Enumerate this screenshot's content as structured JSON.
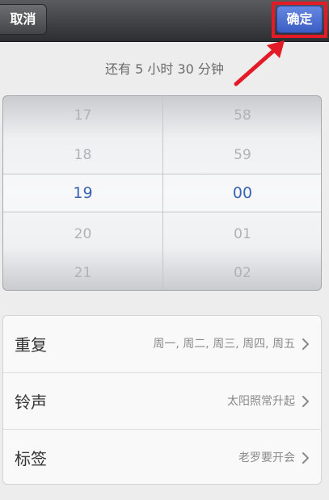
{
  "navbar": {
    "cancel_label": "取消",
    "confirm_label": "确定"
  },
  "remaining_text": "还有 5 小时 30 分钟",
  "picker": {
    "hours": [
      "17",
      "18",
      "19",
      "20",
      "21"
    ],
    "minutes": [
      "58",
      "59",
      "00",
      "01",
      "02"
    ],
    "selected_hour": "19",
    "selected_minute": "00"
  },
  "settings": [
    {
      "label": "重复",
      "value": "周一, 周二, 周三, 周四, 周五"
    },
    {
      "label": "铃声",
      "value": "太阳照常升起"
    },
    {
      "label": "标签",
      "value": "老罗要开会"
    }
  ],
  "colors": {
    "navbar": "#2c2e32",
    "confirm_button": "#3a5dc4",
    "highlight_frame": "#e21b26",
    "selected_text": "#3b63b4"
  },
  "icons": {
    "arrow": "arrow-icon",
    "chevron": "chevron-right-icon"
  }
}
